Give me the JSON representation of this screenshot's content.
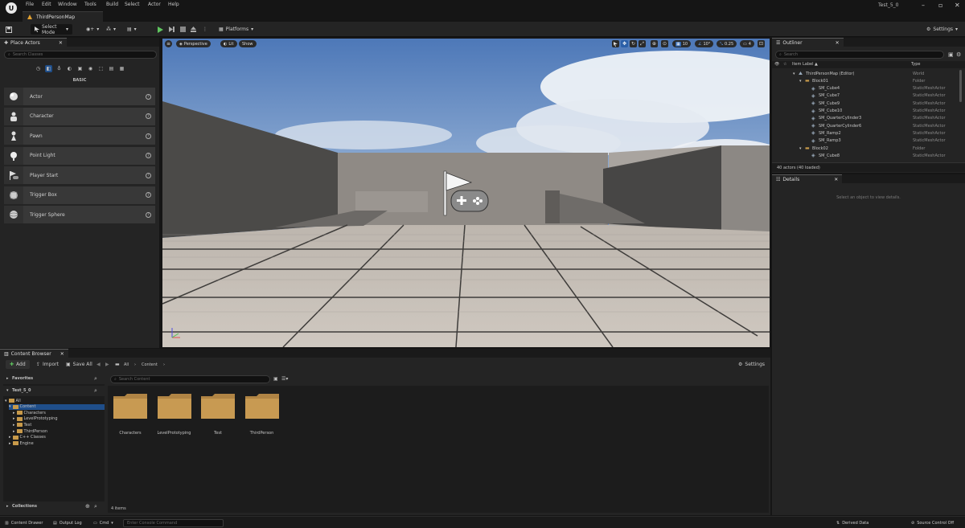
{
  "app": {
    "menu": [
      "File",
      "Edit",
      "Window",
      "Tools",
      "Build",
      "Select",
      "Actor",
      "Help"
    ],
    "doc_tab": "ThirdPersonMap",
    "project": "Test_5_0"
  },
  "toolbar": {
    "select_mode": "Select Mode",
    "platforms": "Platforms",
    "settings": "Settings"
  },
  "place_actors": {
    "tab": "Place Actors",
    "search_placeholder": "Search Classes",
    "category": "BASIC",
    "items": [
      {
        "label": "Actor",
        "icon": "sphere-icon"
      },
      {
        "label": "Character",
        "icon": "character-icon"
      },
      {
        "label": "Pawn",
        "icon": "pawn-icon"
      },
      {
        "label": "Point Light",
        "icon": "point-light-icon"
      },
      {
        "label": "Player Start",
        "icon": "player-start-icon"
      },
      {
        "label": "Trigger Box",
        "icon": "trigger-box-icon"
      },
      {
        "label": "Trigger Sphere",
        "icon": "trigger-sphere-icon"
      }
    ]
  },
  "viewport": {
    "perspective": "Perspective",
    "lit": "Lit",
    "show": "Show",
    "grid_snap": "10",
    "rot_snap": "10°",
    "scale_snap": "0.25",
    "cam_speed": "4"
  },
  "outliner": {
    "tab": "Outliner",
    "search_placeholder": "Search",
    "col_label": "Item Label ▲",
    "col_type": "Type",
    "rows": [
      {
        "label": "ThirdPersonMap (Editor)",
        "type": "World",
        "indent": 0,
        "kind": "world"
      },
      {
        "label": "Block01",
        "type": "Folder",
        "indent": 1,
        "kind": "folder"
      },
      {
        "label": "SM_Cube4",
        "type": "StaticMeshActor",
        "indent": 2,
        "kind": "mesh"
      },
      {
        "label": "SM_Cube7",
        "type": "StaticMeshActor",
        "indent": 2,
        "kind": "mesh"
      },
      {
        "label": "SM_Cube9",
        "type": "StaticMeshActor",
        "indent": 2,
        "kind": "mesh"
      },
      {
        "label": "SM_Cube10",
        "type": "StaticMeshActor",
        "indent": 2,
        "kind": "mesh"
      },
      {
        "label": "SM_QuarterCylinder3",
        "type": "StaticMeshActor",
        "indent": 2,
        "kind": "mesh"
      },
      {
        "label": "SM_QuarterCylinder6",
        "type": "StaticMeshActor",
        "indent": 2,
        "kind": "mesh"
      },
      {
        "label": "SM_Ramp2",
        "type": "StaticMeshActor",
        "indent": 2,
        "kind": "mesh"
      },
      {
        "label": "SM_Ramp3",
        "type": "StaticMeshActor",
        "indent": 2,
        "kind": "mesh"
      },
      {
        "label": "Block02",
        "type": "Folder",
        "indent": 1,
        "kind": "folder"
      },
      {
        "label": "SM_Cube8",
        "type": "StaticMeshActor",
        "indent": 2,
        "kind": "mesh"
      }
    ],
    "count": "40 actors (40 loaded)"
  },
  "details": {
    "tab": "Details",
    "empty": "Select an object to view details."
  },
  "content_browser": {
    "tab": "Content Browser",
    "add": "Add",
    "import": "Import",
    "save_all": "Save All",
    "path_all": "All",
    "path_content": "Content",
    "settings": "Settings",
    "search_placeholder": "Search Content",
    "favorites": "Favorites",
    "project": "Test_5_0",
    "collections": "Collections",
    "items_count": "4 items",
    "tree": [
      {
        "label": "All",
        "indent": 0
      },
      {
        "label": "Content",
        "indent": 1
      },
      {
        "label": "Characters",
        "indent": 2
      },
      {
        "label": "LevelPrototyping",
        "indent": 2
      },
      {
        "label": "Test",
        "indent": 2
      },
      {
        "label": "ThirdPerson",
        "indent": 2
      },
      {
        "label": "C++ Classes",
        "indent": 1
      },
      {
        "label": "Engine",
        "indent": 1
      }
    ],
    "folders": [
      "Characters",
      "LevelPrototyping",
      "Test",
      "ThirdPerson"
    ]
  },
  "statusbar": {
    "content_drawer": "Content Drawer",
    "output_log": "Output Log",
    "cmd": "Cmd",
    "console_placeholder": "Enter Console Command",
    "derived_data": "Derived Data",
    "source_control": "Source Control Off"
  }
}
